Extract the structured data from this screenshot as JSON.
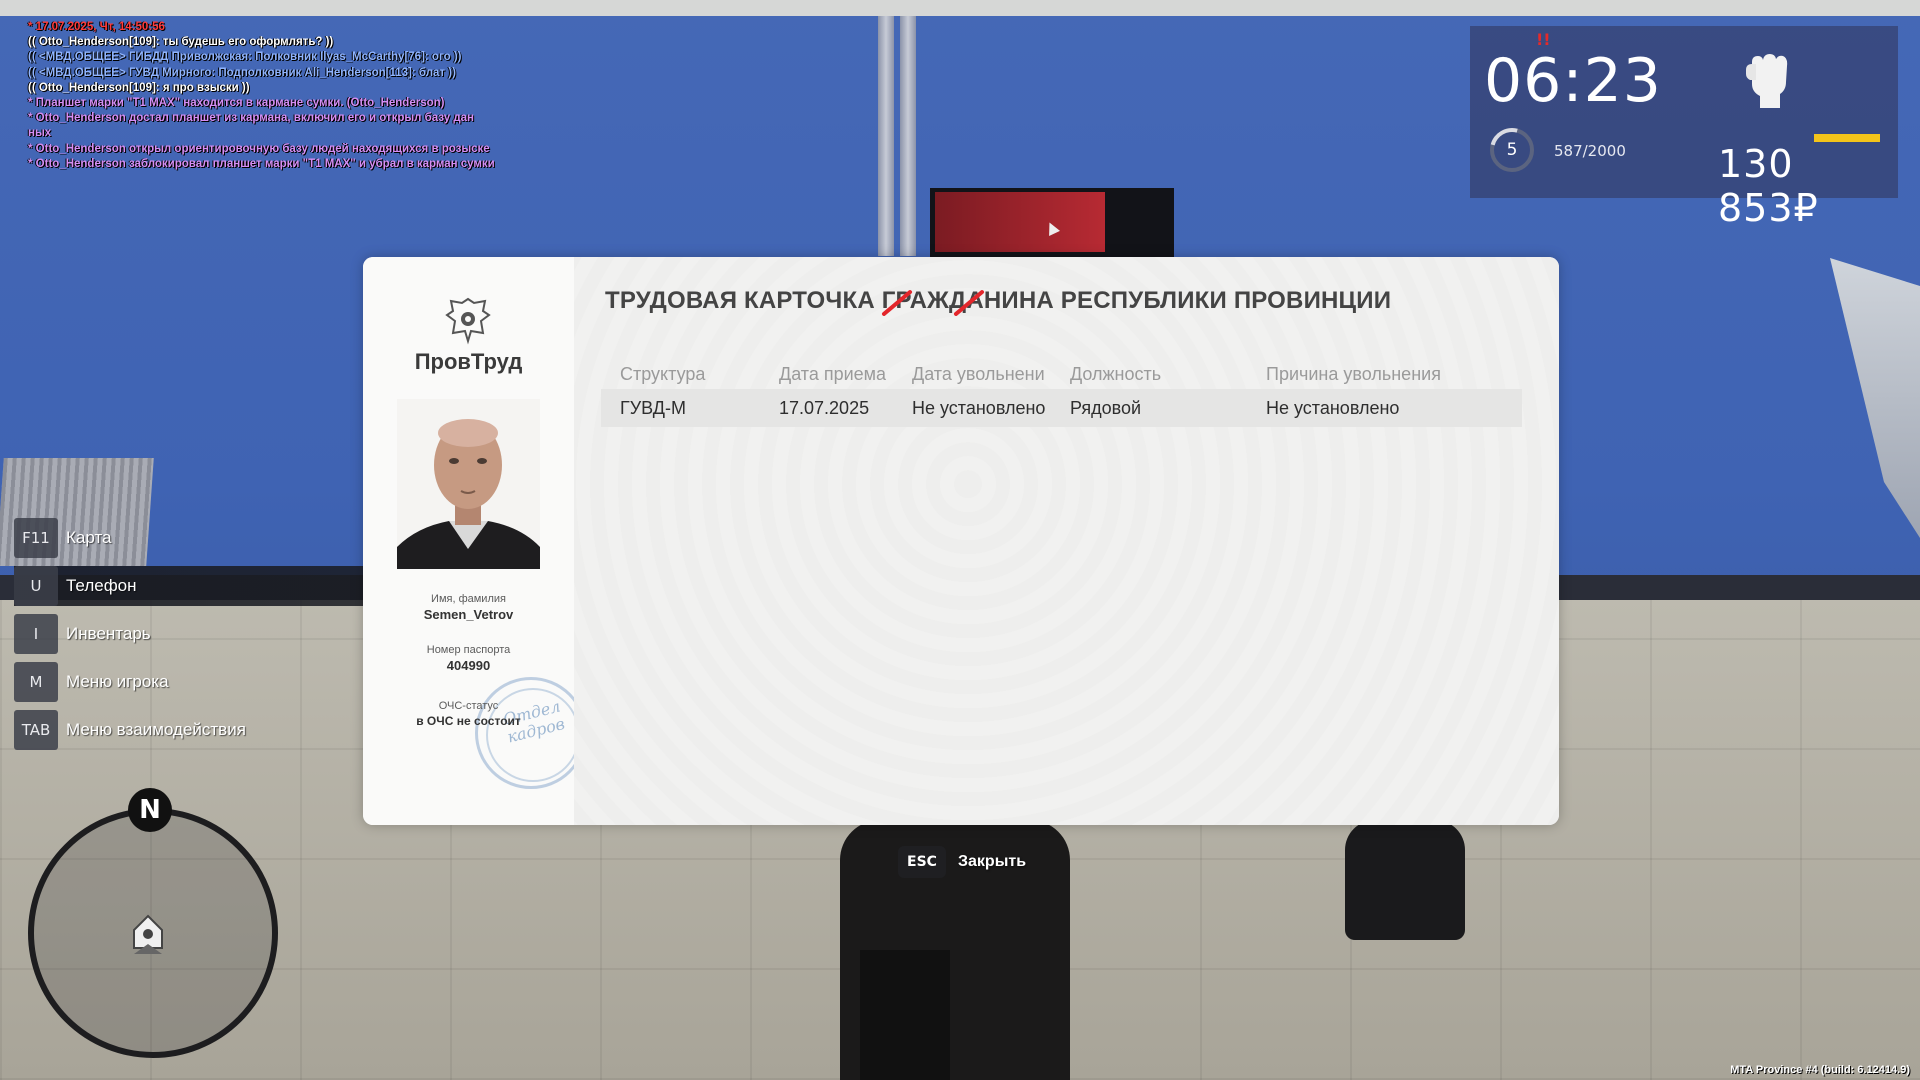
{
  "chat": [
    {
      "text": "* 17.07.2025, Чт, 14:50:56",
      "color": "red"
    },
    {
      "text": "(( Otto_Henderson[109]: ты будешь его оформлять? ))",
      "color": "white"
    },
    {
      "text": "(( <МВД.ОБЩЕЕ> ГИБДД Приволжская: Полковник Ilyas_McCarthy[76]: ого ))",
      "color": "blue"
    },
    {
      "text": "(( <МВД.ОБЩЕЕ> ГУВД Мирного: Подполковник Ali_Henderson[113]: блат ))",
      "color": "blue"
    },
    {
      "text": "(( Otto_Henderson[109]: я про взыски ))",
      "color": "white"
    },
    {
      "text": "* Планшет марки \"T1 MAX\" находится в кармане сумки. (Otto_Henderson)",
      "color": "purple"
    },
    {
      "text": "* Otto_Henderson достал планшет из кармана, включил его и открыл базу дан",
      "color": "purple"
    },
    {
      "text": "ных",
      "color": "purple"
    },
    {
      "text": "* Otto_Henderson открыл ориентировочную базу людей находящихся в розыске",
      "color": "purple"
    },
    {
      "text": "* Otto_Henderson заблокировал планшет марки \"T1 MAX\" и убрал в карман сумки",
      "color": "purple"
    }
  ],
  "hud": {
    "time": "06:23",
    "level": "5",
    "xp": "587/2000",
    "money": "130 853₽",
    "alert": "!!",
    "accent": "#f3c41a"
  },
  "keys": [
    {
      "key": "F11",
      "label": "Карта"
    },
    {
      "key": "U",
      "label": "Телефон"
    },
    {
      "key": "I",
      "label": "Инвентарь"
    },
    {
      "key": "M",
      "label": "Меню игрока"
    },
    {
      "key": "TAB",
      "label": "Меню взаимодействия"
    }
  ],
  "minimap": {
    "north": "N"
  },
  "card": {
    "brand": "ПровТруд",
    "title": "ТРУДОВАЯ КАРТОЧКА ГРАЖДАНИНА РЕСПУБЛИКИ ПРОВИНЦИИ",
    "name_label": "Имя, фамилия",
    "name": "Semen_Vetrov",
    "passport_label": "Номер паспорта",
    "passport": "404990",
    "ochs_label": "ОЧС-статус",
    "ochs": "в ОЧС не состоит",
    "stamp": "Отдел кадров",
    "columns": [
      "Структура",
      "Дата приема",
      "Дата увольнени",
      "Должность",
      "Причина увольнения"
    ],
    "rows": [
      [
        "ГУВД-М",
        "17.07.2025",
        "Не установлено",
        "Рядовой",
        "Не установлено"
      ]
    ]
  },
  "close": {
    "key": "ESC",
    "label": "Закрыть"
  },
  "build": "MTA Province #4 (build: 6.12414.9)"
}
